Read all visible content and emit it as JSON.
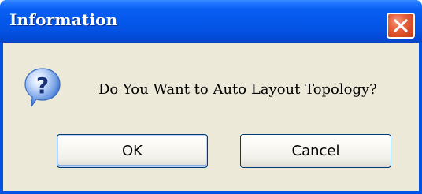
{
  "window": {
    "title": "Information",
    "close_icon": "close-icon"
  },
  "dialog": {
    "icon": "question-icon",
    "icon_glyph": "?",
    "message": "Do You Want to Auto Layout Topology?"
  },
  "buttons": {
    "ok_label": "OK",
    "cancel_label": "Cancel"
  },
  "colors": {
    "titlebar": "#0558ec",
    "client": "#ece9d8",
    "close_button": "#d84a24",
    "icon_blue": "#2a64c8"
  }
}
